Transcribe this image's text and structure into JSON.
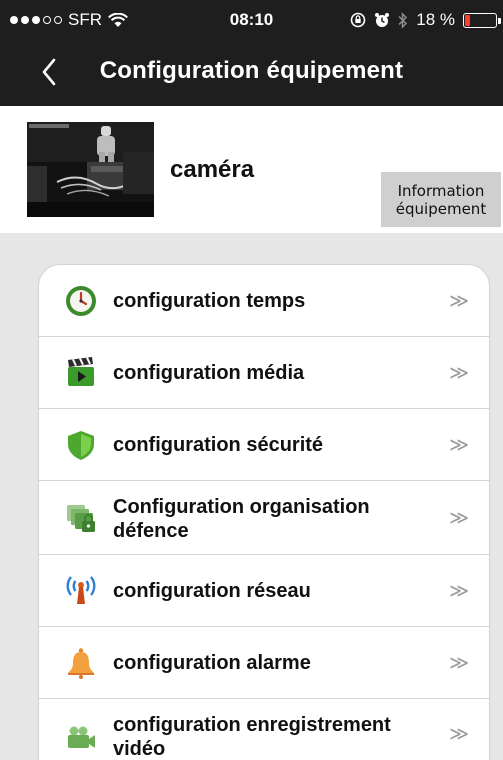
{
  "status_bar": {
    "carrier": "SFR",
    "time": "08:10",
    "battery_percent": "18 %",
    "battery_level": 0.18,
    "signal_bars": 3,
    "signal_max": 5
  },
  "navbar": {
    "title": "Configuration équipement"
  },
  "device": {
    "name": "caméra",
    "info_button_label": "Information équipement",
    "info_button_line1": "Information",
    "info_button_line2": "équipement"
  },
  "menu": {
    "chevron": "≫",
    "items": [
      {
        "label": "configuration temps",
        "icon": "clock-icon"
      },
      {
        "label": "configuration média",
        "icon": "clapperboard-icon"
      },
      {
        "label": "configuration sécurité",
        "icon": "shield-icon"
      },
      {
        "label": "Configuration organisation défence",
        "icon": "lock-folders-icon"
      },
      {
        "label": "configuration réseau",
        "icon": "antenna-icon"
      },
      {
        "label": "configuration alarme",
        "icon": "bell-icon"
      },
      {
        "label": "configuration enregistrement vidéo",
        "icon": "video-camera-icon"
      }
    ]
  }
}
